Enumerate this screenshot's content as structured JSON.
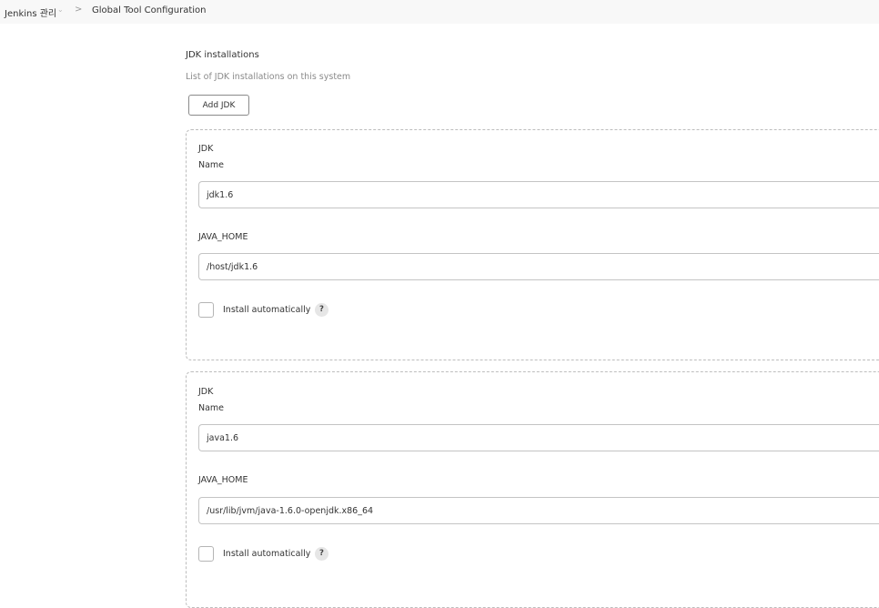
{
  "breadcrumb": {
    "root": "Jenkins 관리",
    "dropdown_icon": "chevron-down-icon",
    "separator": ">",
    "current": "Global Tool Configuration"
  },
  "section": {
    "title": "JDK installations",
    "description": "List of JDK installations on this system",
    "add_button_label": "Add JDK"
  },
  "jdks": [
    {
      "block_title": "JDK",
      "name_label": "Name",
      "name_value": "jdk1.6",
      "java_home_label": "JAVA_HOME",
      "java_home_value": "/host/jdk1.6",
      "install_auto_label": "Install automatically",
      "install_auto_checked": false,
      "help_glyph": "?"
    },
    {
      "block_title": "JDK",
      "name_label": "Name",
      "name_value": "java1.6",
      "java_home_label": "JAVA_HOME",
      "java_home_value": "/usr/lib/jvm/java-1.6.0-openjdk.x86_64",
      "install_auto_label": "Install automatically",
      "install_auto_checked": false,
      "help_glyph": "?"
    }
  ]
}
